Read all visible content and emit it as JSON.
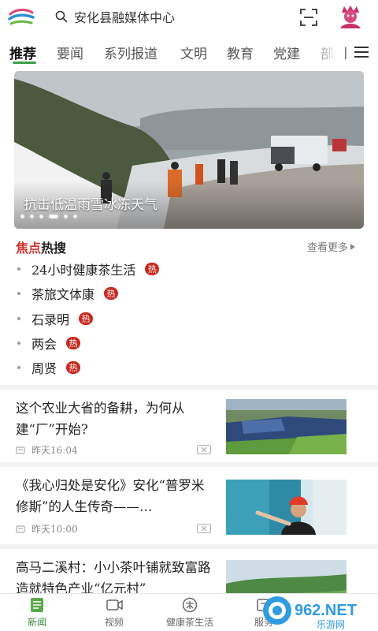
{
  "search": {
    "placeholder": "安化县融媒体中心"
  },
  "tabs": [
    {
      "label": "推荐",
      "active": true
    },
    {
      "label": "要闻"
    },
    {
      "label": "系列报道"
    },
    {
      "label": "文明"
    },
    {
      "label": "教育"
    },
    {
      "label": "党建"
    },
    {
      "label": "部门"
    }
  ],
  "banner": {
    "caption": "抗击低温雨雪冰冻天气",
    "slide_count": 6,
    "active_slide": 3
  },
  "hot_search": {
    "title_red": "焦点",
    "title_black": "热搜",
    "see_more": "查看更多",
    "badge": "热",
    "items": [
      "24小时健康茶生活",
      "茶旅文体康",
      "石录明",
      "两会",
      "周贤"
    ]
  },
  "news": [
    {
      "title": "这个农业大省的备耕，为何从建“厂”开始?",
      "time": "昨天16:04"
    },
    {
      "title": "《我心归处是安化》安化“普罗米修斯”的人生传奇——…",
      "time": "昨天10:00"
    },
    {
      "title": "高马二溪村：小小茶叶铺就致富路 造就特色产业“亿元村”"
    }
  ],
  "bottom_nav": [
    {
      "label": "新闻",
      "active": true
    },
    {
      "label": "视频"
    },
    {
      "label": "健康茶生活"
    },
    {
      "label": "服务"
    }
  ],
  "watermark": {
    "text": "962.NET",
    "subtext": "乐游网"
  },
  "colors": {
    "accent": "#3aa04a",
    "hot_red": "#c8281e",
    "title_red": "#d0342c"
  }
}
